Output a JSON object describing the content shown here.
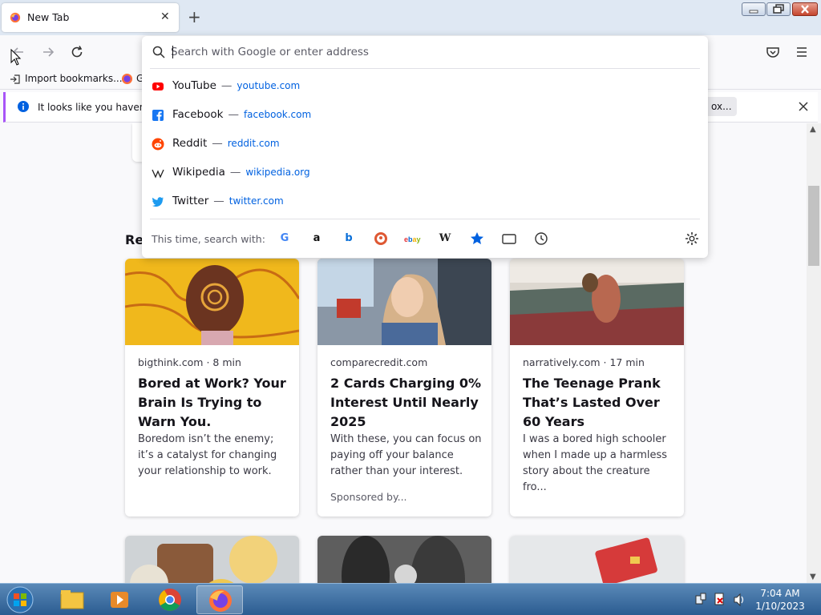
{
  "tab": {
    "title": "New Tab",
    "close": "✕"
  },
  "new_tab": "+",
  "bookmarks": {
    "import": "Import bookmarks...",
    "second": "G"
  },
  "notification": {
    "text": "It looks like you haven't s",
    "button": "ox..."
  },
  "urlbar": {
    "placeholder": "Search with Google or enter address",
    "suggestions": [
      {
        "name": "YouTube",
        "url": "youtube.com"
      },
      {
        "name": "Facebook",
        "url": "facebook.com"
      },
      {
        "name": "Reddit",
        "url": "reddit.com"
      },
      {
        "name": "Wikipedia",
        "url": "wikipedia.org"
      },
      {
        "name": "Twitter",
        "url": "twitter.com"
      }
    ],
    "dash": "—",
    "search_with_label": "This time, search with:",
    "engines": [
      "G",
      "a",
      "b",
      "DDG",
      "ebay",
      "W",
      "bookmarks",
      "tabs",
      "history"
    ]
  },
  "partial_heading": "Re",
  "cards": [
    {
      "source": "bigthink.com · 8 min",
      "headline": "Bored at Work? Your Brain Is Trying to Warn You.",
      "excerpt": "Boredom isn’t the enemy; it’s a catalyst for changing your relationship to work.",
      "sponsored": ""
    },
    {
      "source": "comparecredit.com",
      "headline": "2 Cards Charging 0% Interest Until Nearly 2025",
      "excerpt": "With these, you can focus on paying off your balance rather than your interest.",
      "sponsored": "Sponsored by..."
    },
    {
      "source": "narratively.com · 17 min",
      "headline": "The Teenage Prank That’s Lasted Over 60 Years",
      "excerpt": "I was a bored high schooler when I made up a harmless story about the creature fro...",
      "sponsored": ""
    }
  ],
  "clock": {
    "time": "7:04 AM",
    "date": "1/10/2023"
  },
  "colors": {
    "accent": "#0061e0",
    "firefox_orange": "#ff7139",
    "notif_bar": "#a855f7"
  }
}
